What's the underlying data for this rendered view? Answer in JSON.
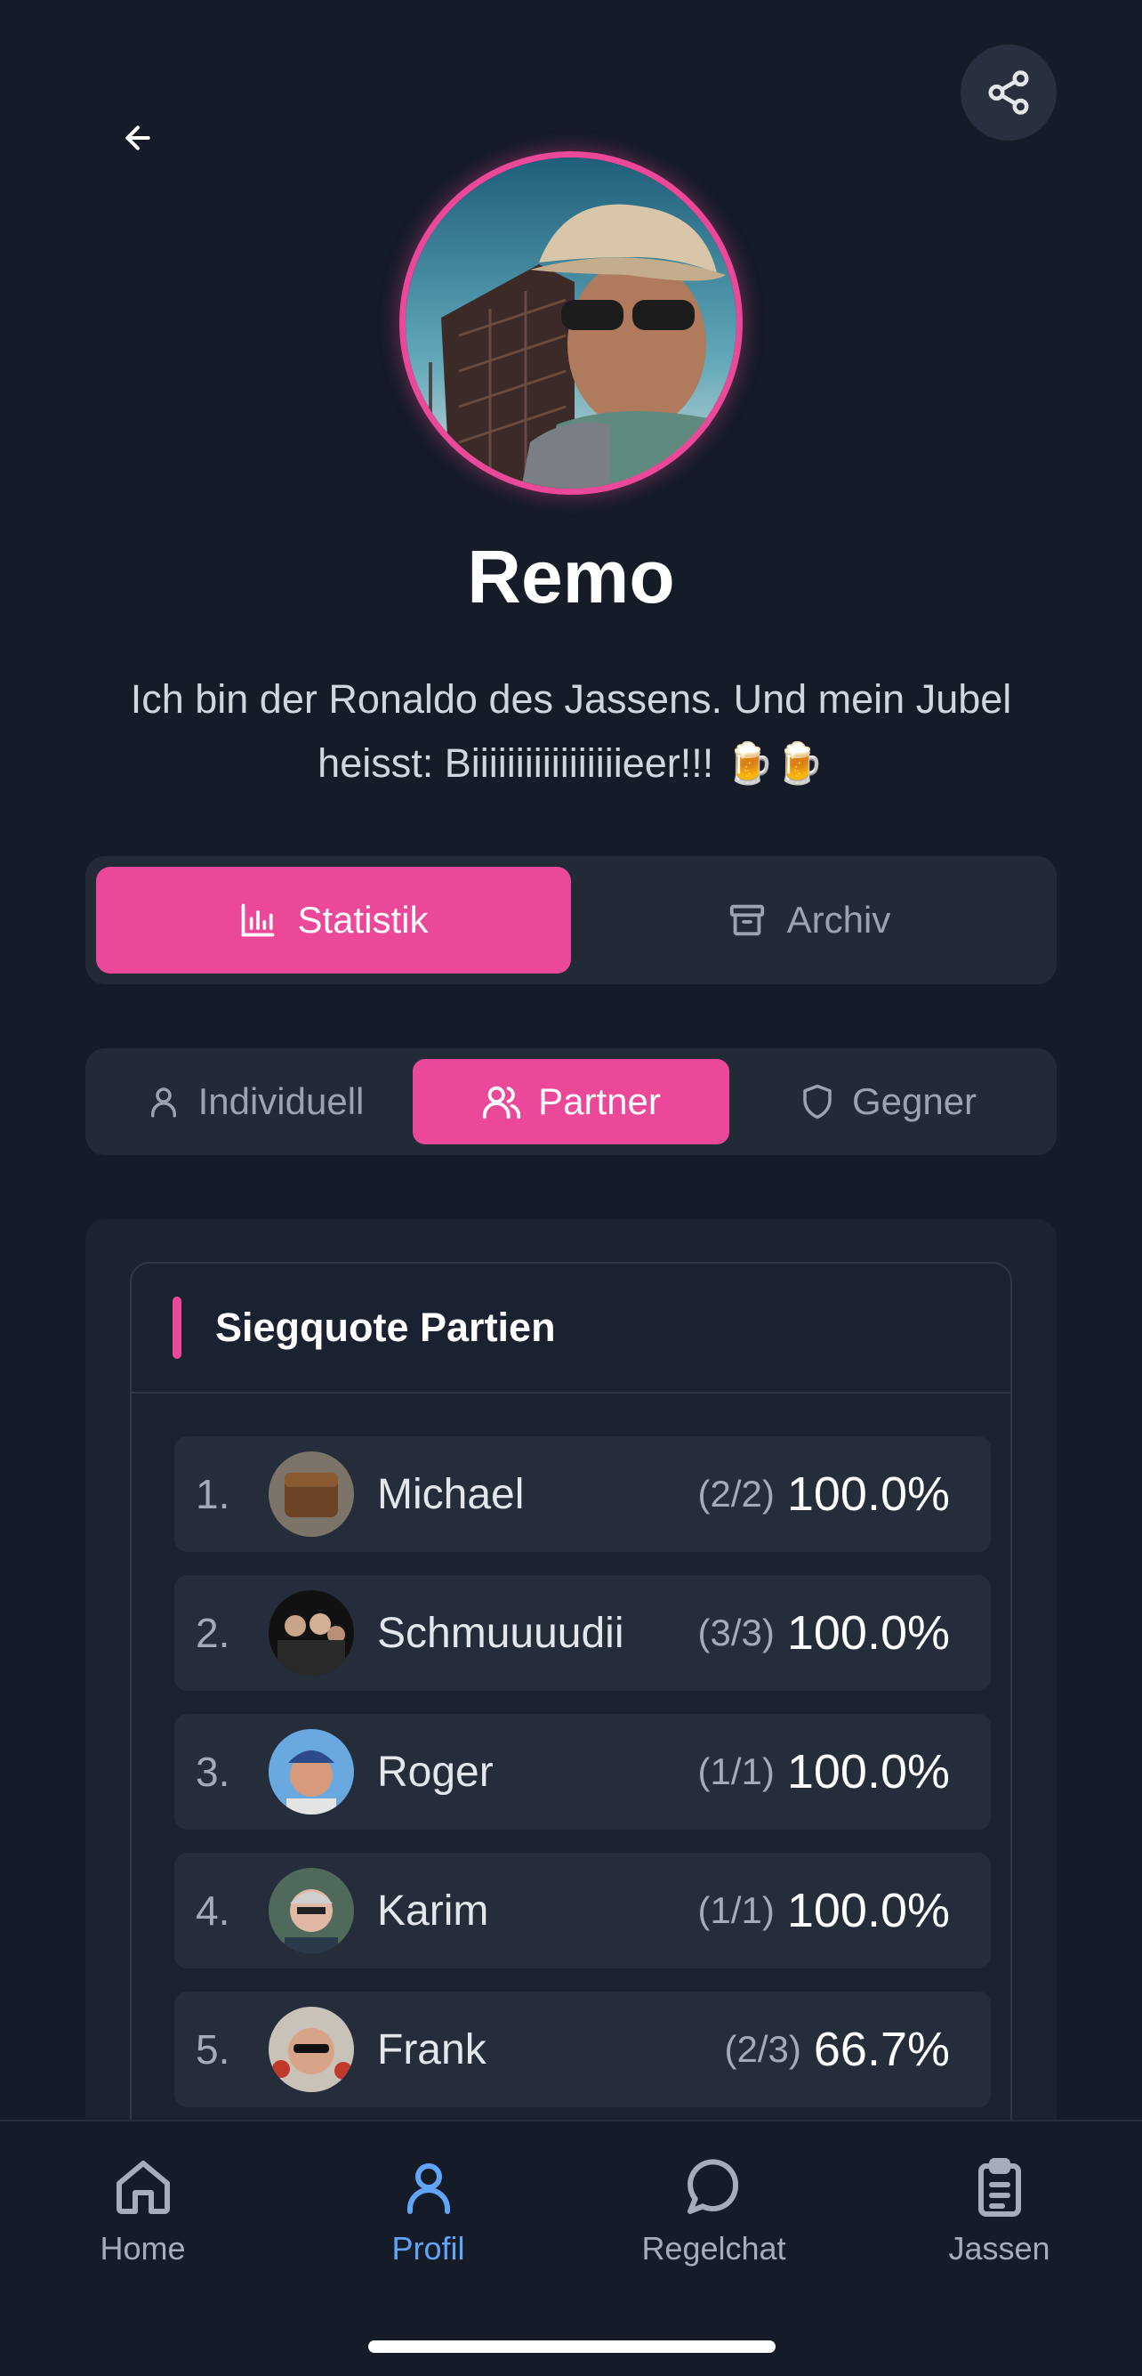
{
  "profile": {
    "name": "Remo",
    "bio": "Ich bin der Ronaldo des Jassens. Und mein Jubel heisst: Biiiiiiiiiiiiiiiiieer!!! 🍺🍺"
  },
  "main_tabs": [
    {
      "label": "Statistik",
      "icon": "bar-chart-icon",
      "active": true
    },
    {
      "label": "Archiv",
      "icon": "archive-icon",
      "active": false
    }
  ],
  "sub_tabs": [
    {
      "label": "Individuell",
      "icon": "user-icon",
      "active": false
    },
    {
      "label": "Partner",
      "icon": "users-icon",
      "active": true
    },
    {
      "label": "Gegner",
      "icon": "shield-icon",
      "active": false
    }
  ],
  "card": {
    "title": "Siegquote Partien",
    "rows": [
      {
        "rank": "1.",
        "name": "Michael",
        "record": "(2/2)",
        "pct": "100.0%"
      },
      {
        "rank": "2.",
        "name": "Schmuuuudii",
        "record": "(3/3)",
        "pct": "100.0%"
      },
      {
        "rank": "3.",
        "name": "Roger",
        "record": "(1/1)",
        "pct": "100.0%"
      },
      {
        "rank": "4.",
        "name": "Karim",
        "record": "(1/1)",
        "pct": "100.0%"
      },
      {
        "rank": "5.",
        "name": "Frank",
        "record": "(2/3)",
        "pct": "66.7%"
      }
    ]
  },
  "nav": [
    {
      "label": "Home",
      "icon": "home-icon",
      "active": false
    },
    {
      "label": "Profil",
      "icon": "profile-icon",
      "active": true
    },
    {
      "label": "Regelchat",
      "icon": "chat-icon",
      "active": false
    },
    {
      "label": "Jassen",
      "icon": "clipboard-icon",
      "active": false
    }
  ],
  "colors": {
    "accent": "#ec4899",
    "nav_active": "#60a5fa",
    "background": "#151b27"
  }
}
